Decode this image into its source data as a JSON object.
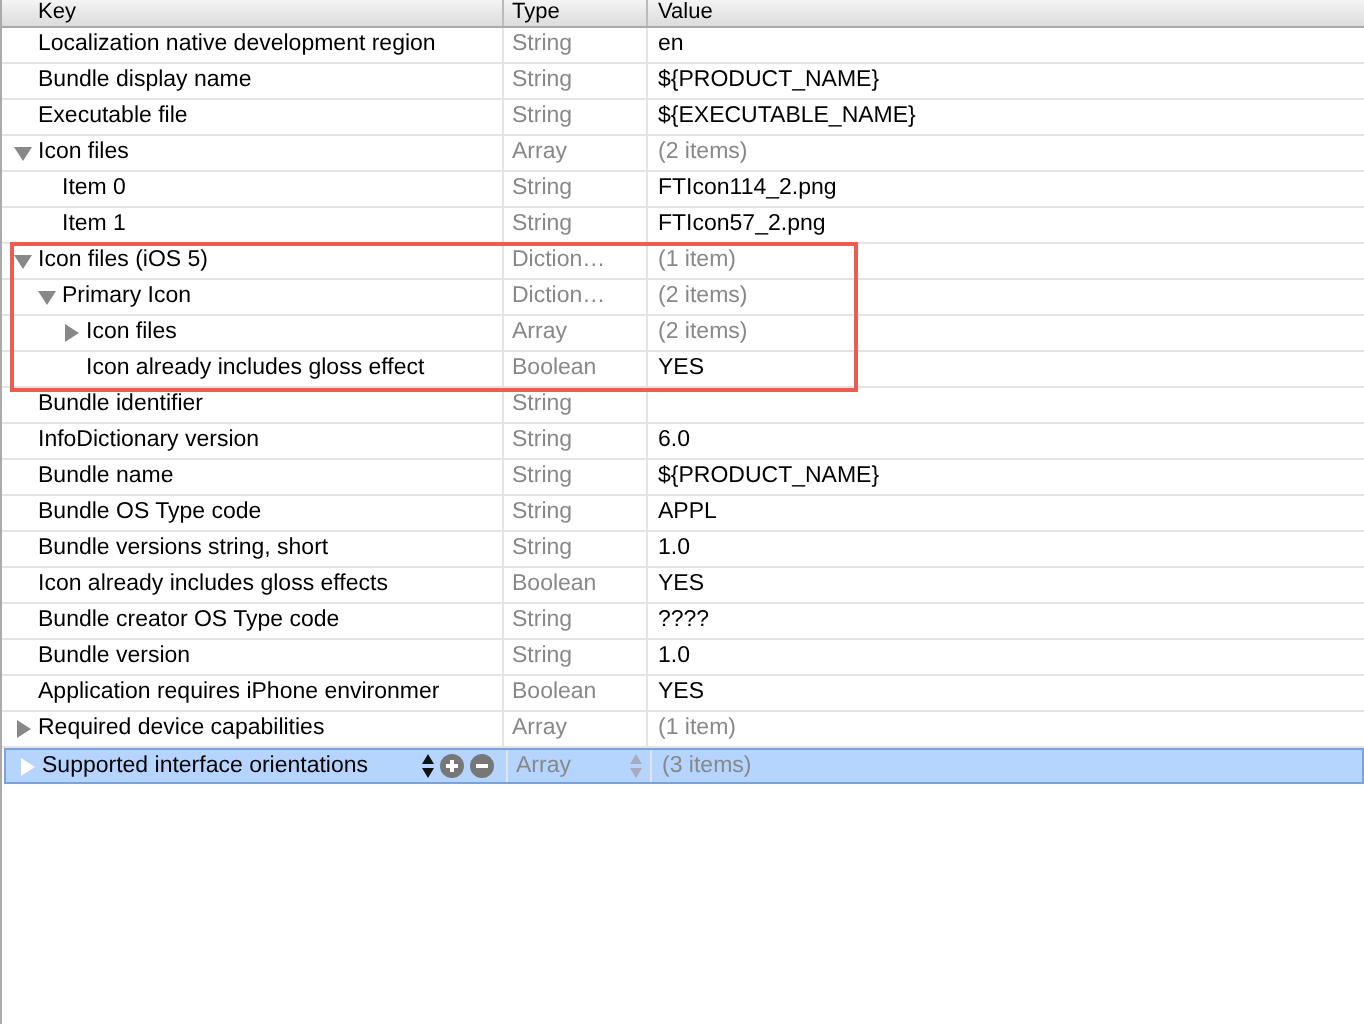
{
  "columns": [
    "Key",
    "Type",
    "Value"
  ],
  "rows": [
    {
      "key": "Localization native development region",
      "type": "String",
      "value": "en"
    },
    {
      "key": "Bundle display name",
      "type": "String",
      "value": "${PRODUCT_NAME}"
    },
    {
      "key": "Executable file",
      "type": "String",
      "value": "${EXECUTABLE_NAME}"
    },
    {
      "key": "Icon files",
      "type": "Array",
      "value": "(2 items)",
      "expanded": true,
      "children": [
        {
          "key": "Item 0",
          "type": "String",
          "value": "FTIcon114_2.png"
        },
        {
          "key": "Item 1",
          "type": "String",
          "value": "FTIcon57_2.png"
        }
      ]
    },
    {
      "key": "Icon files (iOS 5)",
      "type": "Diction…",
      "value": "(1 item)",
      "expanded": true,
      "highlighted": true,
      "children": [
        {
          "key": "Primary Icon",
          "type": "Diction…",
          "value": "(2 items)",
          "expanded": true,
          "children": [
            {
              "key": "Icon files",
              "type": "Array",
              "value": "(2 items)",
              "expanded": false
            },
            {
              "key": "Icon already includes gloss effect",
              "type": "Boolean",
              "value": "YES"
            }
          ]
        }
      ]
    },
    {
      "key": "Bundle identifier",
      "type": "String"
    },
    {
      "key": "InfoDictionary version",
      "type": "String",
      "value": "6.0"
    },
    {
      "key": "Bundle name",
      "type": "String",
      "value": "${PRODUCT_NAME}"
    },
    {
      "key": "Bundle OS Type code",
      "type": "String",
      "value": "APPL"
    },
    {
      "key": "Bundle versions string, short",
      "type": "String",
      "value": "1.0"
    },
    {
      "key": "Icon already includes gloss effects",
      "type": "Boolean",
      "value": "YES"
    },
    {
      "key": "Bundle creator OS Type code",
      "type": "String",
      "value": "????"
    },
    {
      "key": "Bundle version",
      "type": "String",
      "value": "1.0"
    },
    {
      "key": "Application requires iPhone environmer",
      "type": "Boolean",
      "value": "YES"
    },
    {
      "key": "Required device capabilities",
      "type": "Array",
      "value": "(1 item)",
      "expanded": false
    },
    {
      "key": "Supported interface orientations",
      "type": "Array",
      "value": "(3 items)",
      "expanded": false,
      "selected": true
    }
  ]
}
